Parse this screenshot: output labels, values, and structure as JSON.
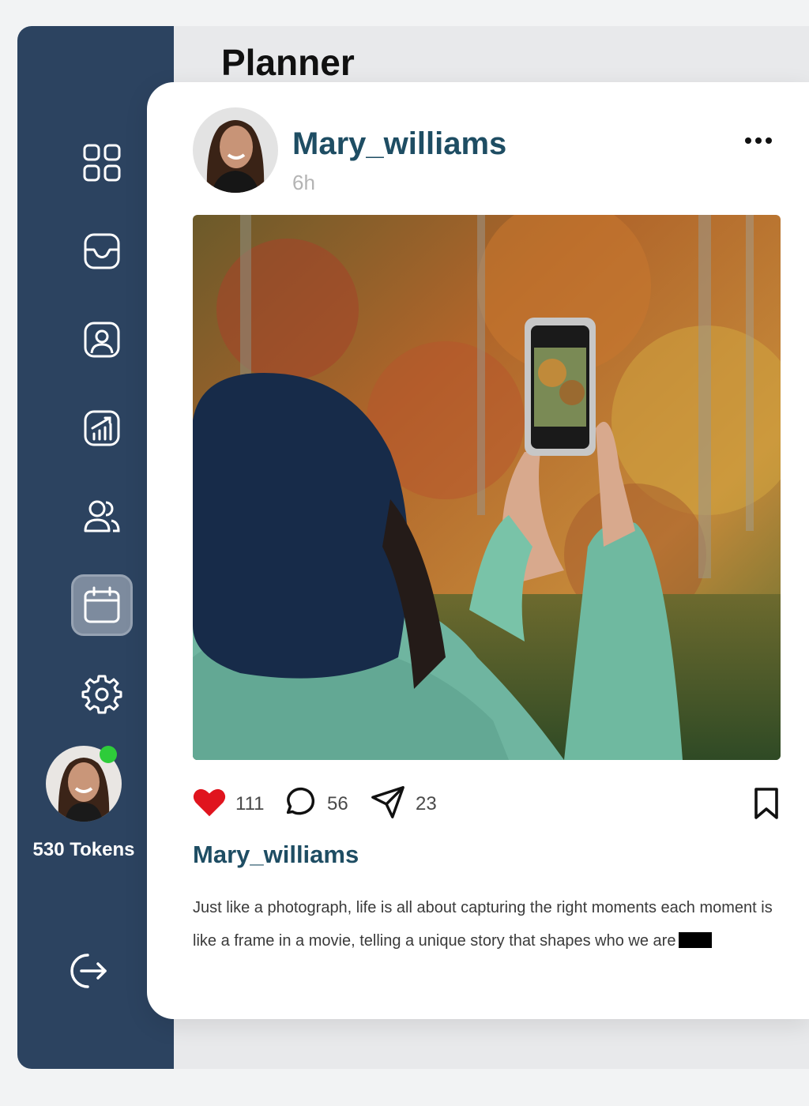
{
  "page": {
    "title": "Planner"
  },
  "sidebar": {
    "items": [
      {
        "name": "dashboard",
        "icon": "grid-icon",
        "active": false
      },
      {
        "name": "inbox",
        "icon": "inbox-icon",
        "active": false
      },
      {
        "name": "profile",
        "icon": "user-portrait-icon",
        "active": false
      },
      {
        "name": "analytics",
        "icon": "chart-growth-icon",
        "active": false
      },
      {
        "name": "team",
        "icon": "users-icon",
        "active": false
      },
      {
        "name": "planner",
        "icon": "calendar-icon",
        "active": true
      },
      {
        "name": "settings",
        "icon": "gear-icon",
        "active": false
      }
    ],
    "tokens_label": "530 Tokens",
    "online_status_color": "#2ecc3a",
    "logout_icon": "logout-icon"
  },
  "post": {
    "username": "Mary_williams",
    "time": "6h",
    "likes": "111",
    "comments": "56",
    "shares": "23",
    "caption_username": "Mary_williams",
    "caption": "Just like a photograph, life is all about capturing the right moments each moment is like a frame in a movie, telling a unique story that shapes who we are"
  },
  "colors": {
    "sidebar_bg": "#2c4360",
    "accent_text": "#1e4d63",
    "like_red": "#e0141e"
  }
}
